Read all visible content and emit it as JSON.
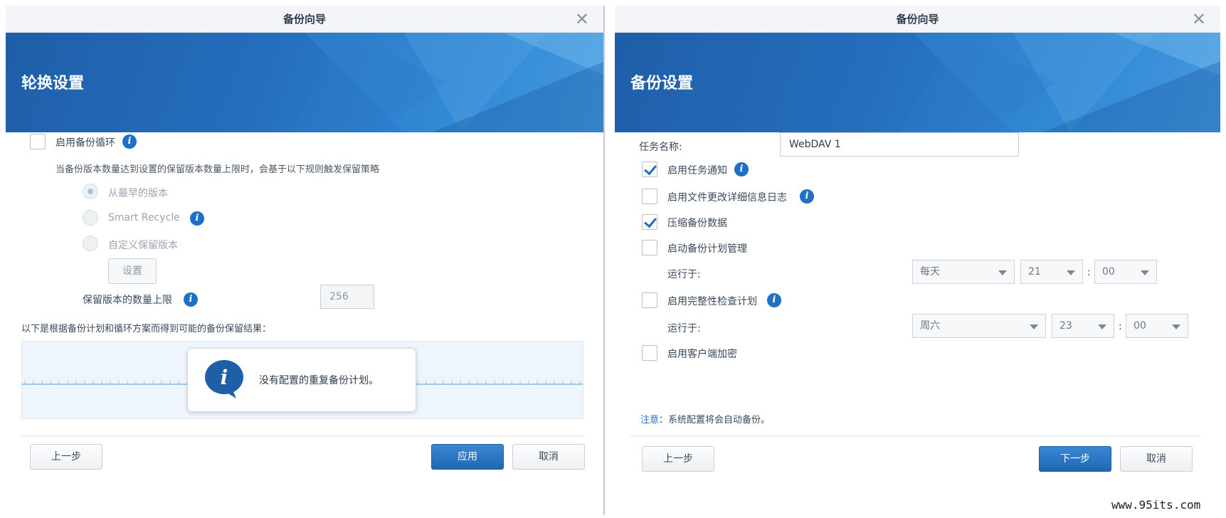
{
  "left": {
    "window_title": "备份向导",
    "banner_title": "轮换设置",
    "enable_rotation_label": "启用备份循环",
    "rotation_desc": "当备份版本数量达到设置的保留版本数量上限时，会基于以下规则触发保留策略",
    "options": [
      "从最早的版本",
      "Smart Recycle",
      "自定义保留版本"
    ],
    "settings_button": "设置",
    "max_versions_label": "保留版本的数量上限",
    "max_versions_value": "256",
    "timeline_caption": "以下是根据备份计划和循环方案而得到可能的备份保留结果：",
    "popup_message": "没有配置的重复备份计划。",
    "prev_button": "上一步",
    "apply_button": "应用",
    "cancel_button": "取消"
  },
  "right": {
    "window_title": "备份向导",
    "banner_title": "备份设置",
    "task_name_label": "任务名称:",
    "task_name_value": "WebDAV 1",
    "enable_notification_label": "启用任务通知",
    "enable_file_log_label": "启用文件更改详细信息日志",
    "compress_label": "压缩备份数据",
    "schedule_label": "启动备份计划管理",
    "run_at_label_1": "运行于:",
    "schedule_day": "每天",
    "schedule_hour": "21",
    "schedule_minute": "00",
    "integrity_label": "启用完整性检查计划",
    "run_at_label_2": "运行于:",
    "integrity_day": "周六",
    "integrity_hour": "23",
    "integrity_minute": "00",
    "time_separator": ":",
    "client_encryption_label": "启用客户端加密",
    "note_label": "注意",
    "note_text": "：系统配置将会自动备份。",
    "prev_button": "上一步",
    "next_button": "下一步",
    "cancel_button": "取消"
  },
  "checked_states": {
    "enable_rotation": false,
    "enable_notification": true,
    "enable_file_log": false,
    "compress": true,
    "schedule": false,
    "integrity": false,
    "client_encryption": false
  },
  "watermark": "www.95its.com",
  "colors": {
    "accent": "#1f6fc6",
    "banner": "#256fbe",
    "primary_button": "#2a77c4"
  }
}
